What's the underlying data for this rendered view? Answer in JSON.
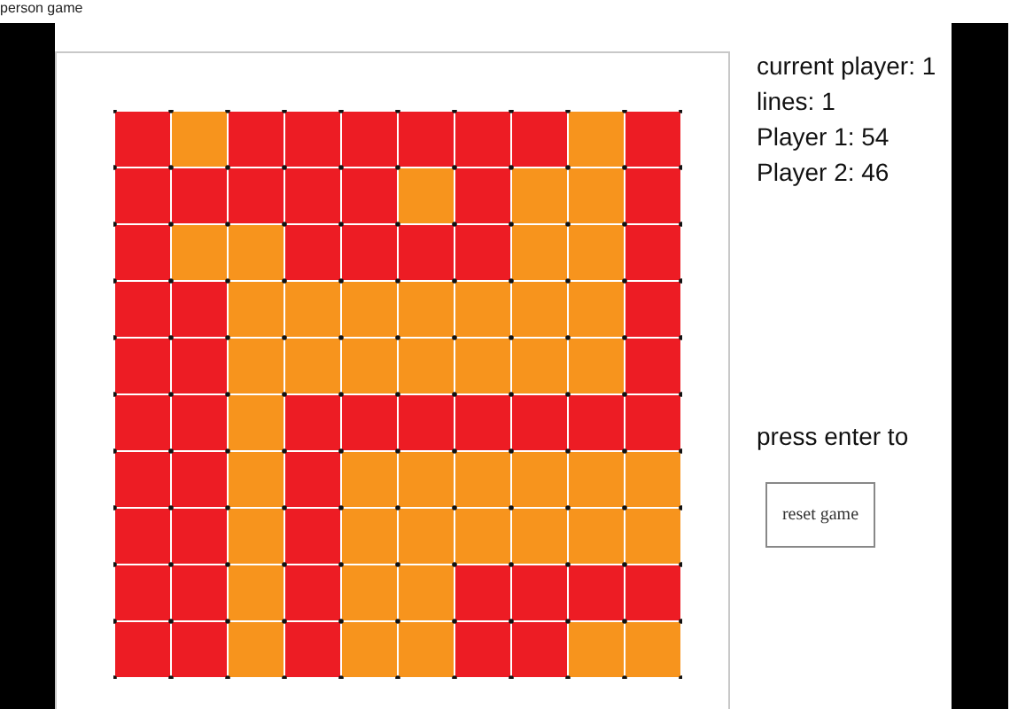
{
  "window": {
    "title": "person game"
  },
  "board": {
    "rows": [
      {
        "cells": [
          {
            "color": "#ed1c24"
          },
          {
            "color": "#f7941d"
          },
          {
            "color": "#ed1c24"
          },
          {
            "color": "#ed1c24"
          },
          {
            "color": "#ed1c24"
          },
          {
            "color": "#ed1c24"
          },
          {
            "color": "#ed1c24"
          },
          {
            "color": "#ed1c24"
          },
          {
            "color": "#f7941d"
          },
          {
            "color": "#ed1c24"
          }
        ]
      },
      {
        "cells": [
          {
            "color": "#ed1c24"
          },
          {
            "color": "#ed1c24"
          },
          {
            "color": "#ed1c24"
          },
          {
            "color": "#ed1c24"
          },
          {
            "color": "#ed1c24"
          },
          {
            "color": "#f7941d"
          },
          {
            "color": "#ed1c24"
          },
          {
            "color": "#f7941d"
          },
          {
            "color": "#f7941d"
          },
          {
            "color": "#ed1c24"
          }
        ]
      },
      {
        "cells": [
          {
            "color": "#ed1c24"
          },
          {
            "color": "#f7941d"
          },
          {
            "color": "#f7941d"
          },
          {
            "color": "#ed1c24"
          },
          {
            "color": "#ed1c24"
          },
          {
            "color": "#ed1c24"
          },
          {
            "color": "#ed1c24"
          },
          {
            "color": "#f7941d"
          },
          {
            "color": "#f7941d"
          },
          {
            "color": "#ed1c24"
          }
        ]
      },
      {
        "cells": [
          {
            "color": "#ed1c24"
          },
          {
            "color": "#ed1c24"
          },
          {
            "color": "#f7941d"
          },
          {
            "color": "#f7941d"
          },
          {
            "color": "#f7941d"
          },
          {
            "color": "#f7941d"
          },
          {
            "color": "#f7941d"
          },
          {
            "color": "#f7941d"
          },
          {
            "color": "#f7941d"
          },
          {
            "color": "#ed1c24"
          }
        ]
      },
      {
        "cells": [
          {
            "color": "#ed1c24"
          },
          {
            "color": "#ed1c24"
          },
          {
            "color": "#f7941d"
          },
          {
            "color": "#f7941d"
          },
          {
            "color": "#f7941d"
          },
          {
            "color": "#f7941d"
          },
          {
            "color": "#f7941d"
          },
          {
            "color": "#f7941d"
          },
          {
            "color": "#f7941d"
          },
          {
            "color": "#ed1c24"
          }
        ]
      },
      {
        "cells": [
          {
            "color": "#ed1c24"
          },
          {
            "color": "#ed1c24"
          },
          {
            "color": "#f7941d"
          },
          {
            "color": "#ed1c24"
          },
          {
            "color": "#ed1c24"
          },
          {
            "color": "#ed1c24"
          },
          {
            "color": "#ed1c24"
          },
          {
            "color": "#ed1c24"
          },
          {
            "color": "#ed1c24"
          },
          {
            "color": "#ed1c24"
          }
        ]
      },
      {
        "cells": [
          {
            "color": "#ed1c24"
          },
          {
            "color": "#ed1c24"
          },
          {
            "color": "#f7941d"
          },
          {
            "color": "#ed1c24"
          },
          {
            "color": "#f7941d"
          },
          {
            "color": "#f7941d"
          },
          {
            "color": "#f7941d"
          },
          {
            "color": "#f7941d"
          },
          {
            "color": "#f7941d"
          },
          {
            "color": "#f7941d"
          }
        ]
      },
      {
        "cells": [
          {
            "color": "#ed1c24"
          },
          {
            "color": "#ed1c24"
          },
          {
            "color": "#f7941d"
          },
          {
            "color": "#ed1c24"
          },
          {
            "color": "#f7941d"
          },
          {
            "color": "#f7941d"
          },
          {
            "color": "#f7941d"
          },
          {
            "color": "#f7941d"
          },
          {
            "color": "#f7941d"
          },
          {
            "color": "#f7941d"
          }
        ]
      },
      {
        "cells": [
          {
            "color": "#ed1c24"
          },
          {
            "color": "#ed1c24"
          },
          {
            "color": "#f7941d"
          },
          {
            "color": "#ed1c24"
          },
          {
            "color": "#f7941d"
          },
          {
            "color": "#f7941d"
          },
          {
            "color": "#ed1c24"
          },
          {
            "color": "#ed1c24"
          },
          {
            "color": "#ed1c24"
          },
          {
            "color": "#ed1c24"
          }
        ]
      },
      {
        "cells": [
          {
            "color": "#ed1c24"
          },
          {
            "color": "#ed1c24"
          },
          {
            "color": "#f7941d"
          },
          {
            "color": "#ed1c24"
          },
          {
            "color": "#f7941d"
          },
          {
            "color": "#f7941d"
          },
          {
            "color": "#ed1c24"
          },
          {
            "color": "#ed1c24"
          },
          {
            "color": "#f7941d"
          },
          {
            "color": "#f7941d"
          }
        ]
      }
    ]
  },
  "status": [
    "current player: 1",
    "lines:  1",
    "Player 1: 54",
    "Player 2: 46"
  ],
  "hint": "press enter to",
  "reset_button": "reset game"
}
